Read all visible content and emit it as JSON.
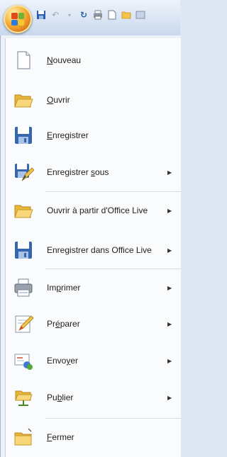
{
  "menu": {
    "items": [
      {
        "name": "new",
        "mnemonic": "N",
        "rest": "ouveau",
        "tail": "",
        "submenu": false
      },
      {
        "name": "open",
        "mnemonic": "O",
        "rest": "uvrir",
        "tail": "",
        "submenu": false
      },
      {
        "name": "save",
        "mnemonic": "E",
        "rest": "nregistrer",
        "tail": "",
        "submenu": false
      },
      {
        "name": "save-as",
        "before": "Enregistrer ",
        "mnemonic": "s",
        "rest": "ous",
        "submenu": true
      },
      {
        "name": "open-office-live",
        "label": "Ouvrir à partir d'Office Live",
        "submenu": true
      },
      {
        "name": "save-office-live",
        "label": "Enregistrer dans Office Live",
        "submenu": true
      },
      {
        "name": "print",
        "before": "Im",
        "mnemonic": "p",
        "rest": "rimer",
        "submenu": true
      },
      {
        "name": "prepare",
        "before": "Pr",
        "mnemonic": "é",
        "rest": "parer",
        "submenu": true
      },
      {
        "name": "send",
        "before": "Envo",
        "mnemonic": "y",
        "rest": "er",
        "submenu": true
      },
      {
        "name": "publish",
        "before": "Pu",
        "mnemonic": "b",
        "rest": "lier",
        "submenu": true
      },
      {
        "name": "close",
        "mnemonic": "F",
        "rest": "ermer",
        "tail": "",
        "submenu": false
      }
    ],
    "arrow_glyph": "▶"
  }
}
